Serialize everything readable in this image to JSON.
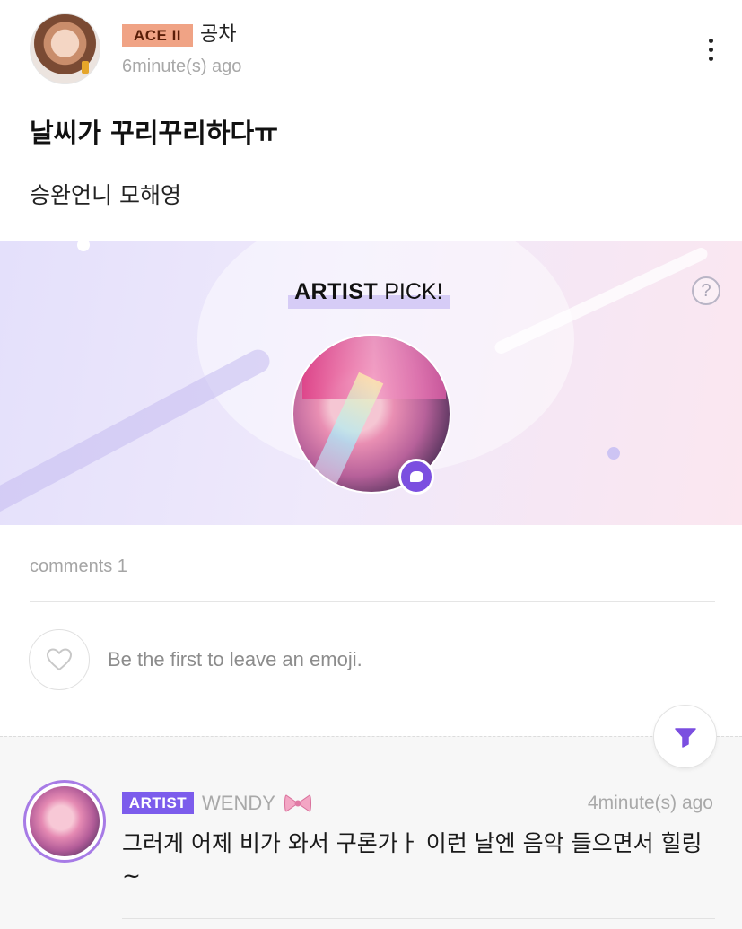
{
  "post": {
    "author": {
      "level_badge": "ACE II",
      "name": "공차",
      "time": "6minute(s) ago",
      "badge_color": "#f0a385"
    },
    "more_icon": "more-vertical-icon",
    "title": "날씨가 꾸리꾸리하다ㅠ",
    "body": "승완언니 모해영"
  },
  "artist_pick": {
    "title_bold": "ARTIST",
    "title_rest": " PICK!",
    "help_label": "?",
    "badge_icon": "chat-bubble-icon",
    "accent": "#7b4fe0"
  },
  "comments": {
    "count_label": "comments 1",
    "emoji_prompt": "Be the first to leave an emoji.",
    "emoji_icon": "heart-outline-icon",
    "filter_icon": "filter-icon",
    "items": [
      {
        "badge": "ARTIST",
        "name": "WENDY",
        "name_icon": "ribbon-bow-icon",
        "time": "4minute(s) ago",
        "text": "그러게 어제 비가 와서 구론가ㅏ 이런 날엔 음악 들으면서 힐링~",
        "badge_color": "#7c5cec"
      }
    ]
  }
}
